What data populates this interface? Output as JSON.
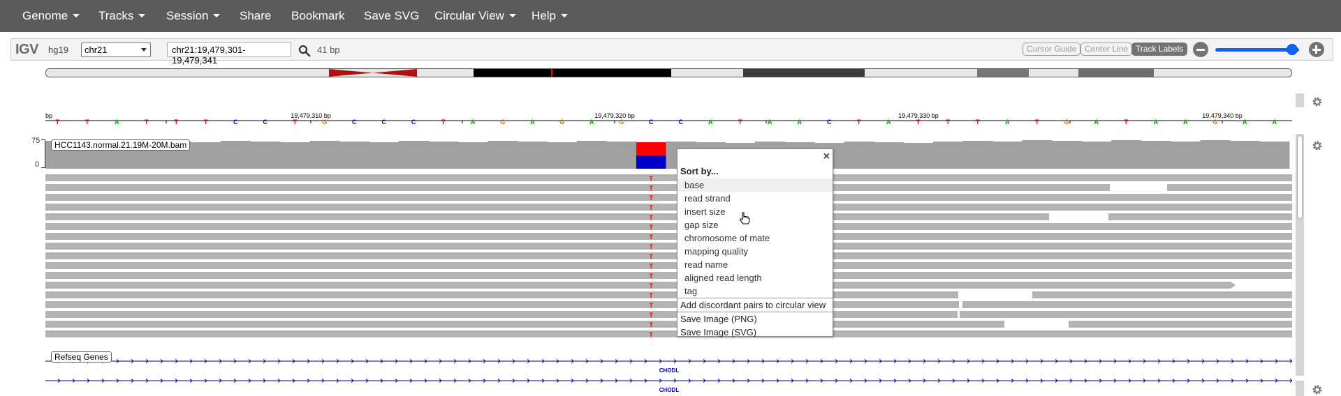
{
  "navbar": {
    "items": [
      {
        "label": "Genome",
        "dropdown": true
      },
      {
        "label": "Tracks",
        "dropdown": true
      },
      {
        "label": "Session",
        "dropdown": true
      },
      {
        "label": "Share",
        "dropdown": false
      },
      {
        "label": "Bookmark",
        "dropdown": false
      },
      {
        "label": "Save SVG",
        "dropdown": false
      },
      {
        "label": "Circular View",
        "dropdown": true
      },
      {
        "label": "Help",
        "dropdown": true
      }
    ]
  },
  "control_bar": {
    "logo": "IGV",
    "genome": "hg19",
    "chromosome": "chr21",
    "locus": "chr21:19,479,301-19,479,341",
    "window_size": "41 bp",
    "buttons": {
      "cursor_guide": "Cursor Guide",
      "center_line": "Center Line",
      "track_labels": "Track Labels"
    },
    "zoom_level_fraction": 0.92
  },
  "ruler": {
    "start_label": "bp",
    "ticks": [
      "19,479,310 bp",
      "19,479,320 bp",
      "19,479,330 bp",
      "19,479,340 bp"
    ]
  },
  "sequence": [
    "T",
    "T",
    "A",
    "T",
    "T",
    "T",
    "C",
    "C",
    "T",
    "G",
    "C",
    "C",
    "C",
    "T",
    "A",
    "G",
    "A",
    "G",
    "A",
    "G",
    "C",
    "C",
    "A",
    "T",
    "A",
    "A",
    "C",
    "T",
    "A",
    "T",
    "T",
    "T",
    "A",
    "T",
    "G",
    "A",
    "T",
    "A",
    "A",
    "G",
    "A",
    "A"
  ],
  "base_colors": {
    "A": "#00a000",
    "C": "#0000c8",
    "G": "#d17105",
    "T": "#ff0000"
  },
  "coverage_track": {
    "name": "HCC1143.normal.21.19M-20M.bam",
    "scale_max": "75",
    "scale_min": "0",
    "mismatch_t_fraction": 0.5,
    "mismatch_colors": {
      "top": "#ff0000",
      "bottom": "#0000cc"
    }
  },
  "alignment_mismatch_base": "T",
  "gene_track": {
    "name": "Refseq Genes",
    "genes": [
      {
        "label": "CHODL"
      },
      {
        "label": "CHODL"
      }
    ],
    "color": "#000096"
  },
  "popup": {
    "close_label": "×",
    "sort_title": "Sort by...",
    "sort_options": [
      "base",
      "read strand",
      "insert size",
      "gap size",
      "chromosome of mate",
      "mapping quality",
      "read name",
      "aligned read length",
      "tag"
    ],
    "highlighted_option": "base",
    "menu_items": [
      "Add discordant pairs to circular view",
      "Save Image (PNG)",
      "Save Image (SVG)"
    ]
  },
  "colors": {
    "navbar": "#5b5b5b",
    "read": "#b4b4b4",
    "coverage": "#a0a0a0",
    "zoom": "#0a64ff"
  }
}
